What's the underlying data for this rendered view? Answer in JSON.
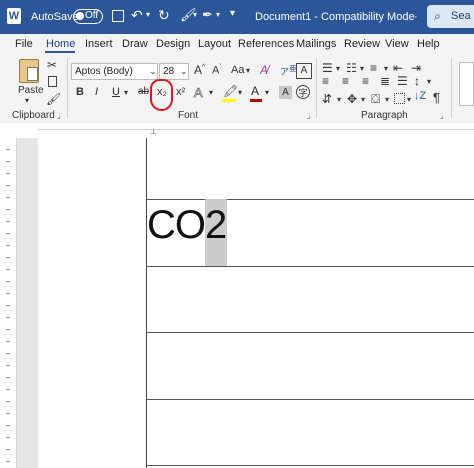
{
  "titlebar": {
    "autosave_label": "AutoSave",
    "autosave_state": "Off",
    "doc_title": "Document1 - Compatibility Mode",
    "separator": "·",
    "search_label": "Sea"
  },
  "menu": {
    "tabs": [
      "File",
      "Home",
      "Insert",
      "Draw",
      "Design",
      "Layout",
      "References",
      "Mailings",
      "Review",
      "View",
      "Help"
    ],
    "active": "Home"
  },
  "ribbon": {
    "clipboard": {
      "paste_label": "Paste",
      "group_label": "Clipboard"
    },
    "font": {
      "font_name": "Aptos (Body)",
      "font_size": "28",
      "group_label": "Font",
      "bold": "B",
      "italic": "I",
      "underline": "U",
      "strike": "ab",
      "subscript": "x₂",
      "superscript": "x²",
      "grow": "A",
      "shrink": "A",
      "case": "Aa",
      "text_effects": "A",
      "font_color": "A",
      "highlight": "A"
    },
    "paragraph": {
      "group_label": "Paragraph",
      "show_marks": "¶"
    }
  },
  "document": {
    "text_main": "CO",
    "text_selected": "2"
  },
  "colors": {
    "title_bg": "#2b579a",
    "ribbon_bg": "#f3f3f3",
    "annotation_red": "#e4161b",
    "font_color_bar": "#c00000",
    "highlight_bar": "#ffff00"
  }
}
